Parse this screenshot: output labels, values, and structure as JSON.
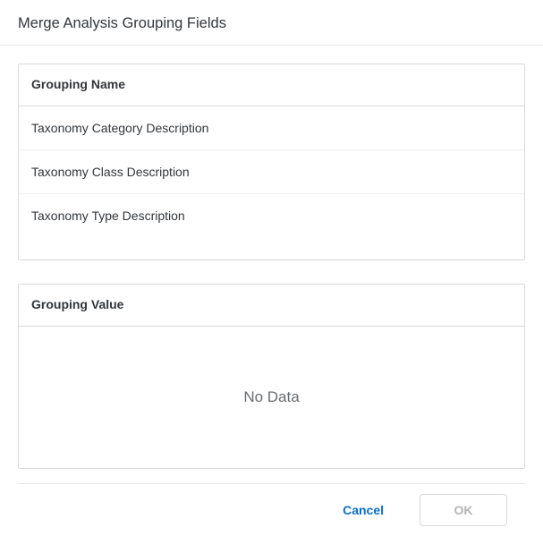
{
  "header": {
    "title": "Merge Analysis Grouping Fields"
  },
  "grouping_name": {
    "header": "Grouping Name",
    "items": [
      {
        "label": "Taxonomy Category Description"
      },
      {
        "label": "Taxonomy Class Description"
      },
      {
        "label": "Taxonomy Type Description"
      }
    ]
  },
  "grouping_value": {
    "header": "Grouping Value",
    "no_data_text": "No Data"
  },
  "footer": {
    "cancel_label": "Cancel",
    "ok_label": "OK"
  }
}
